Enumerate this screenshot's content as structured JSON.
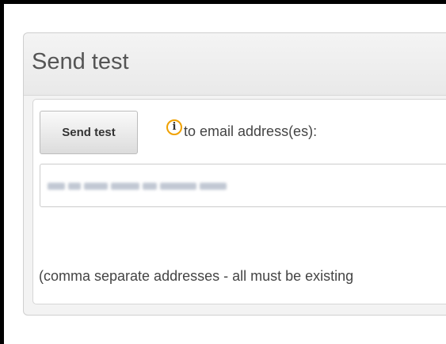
{
  "panel": {
    "title": "Send test"
  },
  "send_test": {
    "button_label": "Send test",
    "info_icon_glyph": "i",
    "to_label": "to email address(es):"
  },
  "email_input": {
    "value": "",
    "placeholder": ""
  },
  "hint_text": "(comma separate addresses - all must be existing",
  "colors": {
    "info_icon": "#f0a100",
    "panel_bg": "#f3f3f3",
    "title_text": "#555555"
  },
  "icons": {
    "info": "info-icon"
  }
}
